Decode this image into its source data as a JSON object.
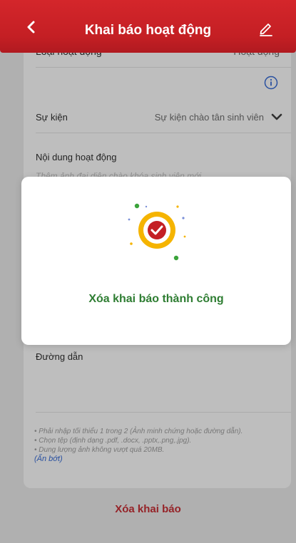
{
  "header": {
    "title": "Khai báo hoạt động"
  },
  "form": {
    "activity_type_label": "Loại hoạt động",
    "activity_type_value": "Hoạt động",
    "event_label": "Sự kiện",
    "event_value": "Sự kiện chào tân sinh viên",
    "content_label": "Nội dung hoạt động",
    "content_preview": "Thêm ảnh đại diện chào khóa sinh viên mới",
    "link_label": "Đường dẫn",
    "notes": [
      "• Phải nhập tối thiểu 1 trong 2 (Ảnh minh chứng hoặc đường dẫn).",
      "• Chọn tệp (định dạng .pdf, .docx, .pptx,.png,.jpg).",
      "• Dung lượng ảnh không vượt quá 20MB."
    ],
    "notes_toggle": "(Ẩn bớt)"
  },
  "actions": {
    "delete_label": "Xóa khai báo"
  },
  "modal": {
    "message": "Xóa khai báo thành công"
  },
  "colors": {
    "header_red": "#c41f24",
    "success_green": "#2e7d32",
    "accent_yellow": "#f5b400"
  }
}
